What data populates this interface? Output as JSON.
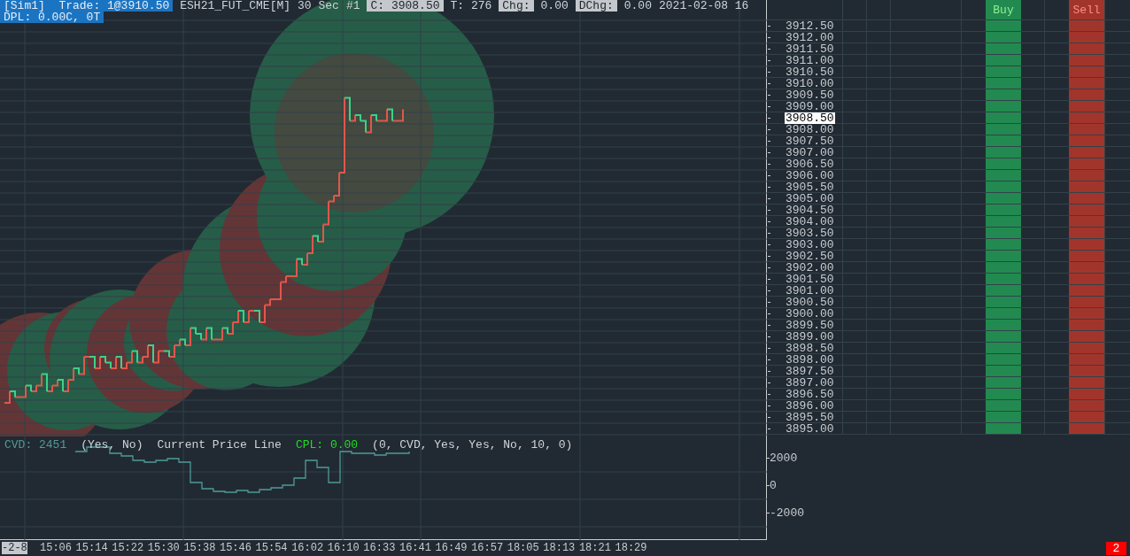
{
  "header": {
    "segments": [
      {
        "text": "[Sim1]  Trade: 1@3910.50",
        "kind": "highlight"
      },
      {
        "text": "ESH21_FUT_CME[M]",
        "kind": "plain"
      },
      {
        "text": "30 Sec",
        "kind": "plain"
      },
      {
        "text": "#1",
        "kind": "plain"
      },
      {
        "text": "C: 3908.50",
        "kind": "tag"
      },
      {
        "text": "T: 276",
        "kind": "plain"
      },
      {
        "text": "Chg:",
        "kind": "tag"
      },
      {
        "text": "0.00",
        "kind": "plain"
      },
      {
        "text": "DChg:",
        "kind": "tag"
      },
      {
        "text": "0.00",
        "kind": "plain"
      },
      {
        "text": "2021-02-08 16",
        "kind": "plain"
      }
    ],
    "dpl": "DPL: 0.00C, 0T"
  },
  "order_columns": [
    {
      "label": "Buy",
      "kind": "buy"
    },
    {
      "label": "Sell",
      "kind": "sell"
    }
  ],
  "prices": [
    {
      "text": "3912.50",
      "current": false
    },
    {
      "text": "3912.00",
      "current": false
    },
    {
      "text": "3911.50",
      "current": false
    },
    {
      "text": "3911.00",
      "current": false
    },
    {
      "text": "3910.50",
      "current": false
    },
    {
      "text": "3910.00",
      "current": false
    },
    {
      "text": "3909.50",
      "current": false
    },
    {
      "text": "3909.00",
      "current": false
    },
    {
      "text": "3908.50",
      "current": true
    },
    {
      "text": "3908.00",
      "current": false
    },
    {
      "text": "3907.50",
      "current": false
    },
    {
      "text": "3907.00",
      "current": false
    },
    {
      "text": "3906.50",
      "current": false
    },
    {
      "text": "3906.00",
      "current": false
    },
    {
      "text": "3905.50",
      "current": false
    },
    {
      "text": "3905.00",
      "current": false
    },
    {
      "text": "3904.50",
      "current": false
    },
    {
      "text": "3904.00",
      "current": false
    },
    {
      "text": "3903.50",
      "current": false
    },
    {
      "text": "3903.00",
      "current": false
    },
    {
      "text": "3902.50",
      "current": false
    },
    {
      "text": "3902.00",
      "current": false
    },
    {
      "text": "3901.50",
      "current": false
    },
    {
      "text": "3901.00",
      "current": false
    },
    {
      "text": "3900.50",
      "current": false
    },
    {
      "text": "3900.00",
      "current": false
    },
    {
      "text": "3899.50",
      "current": false
    },
    {
      "text": "3899.00",
      "current": false
    },
    {
      "text": "3898.50",
      "current": false
    },
    {
      "text": "3898.00",
      "current": false
    },
    {
      "text": "3897.50",
      "current": false
    },
    {
      "text": "3897.00",
      "current": false
    },
    {
      "text": "3896.50",
      "current": false
    },
    {
      "text": "3896.00",
      "current": false
    },
    {
      "text": "3895.50",
      "current": false
    },
    {
      "text": "3895.00",
      "current": false
    }
  ],
  "indicator": {
    "segments": [
      {
        "text": "CVD: 2451",
        "kind": "cvd"
      },
      {
        "text": "(Yes, No)",
        "kind": "plain"
      },
      {
        "text": "Current Price Line",
        "kind": "plain"
      },
      {
        "text": "CPL: 0.00",
        "kind": "cpl"
      },
      {
        "text": "(0, CVD, Yes, Yes, No, 10, 0)",
        "kind": "plain"
      }
    ],
    "axis": [
      "2000",
      "0",
      "-2000"
    ]
  },
  "time_axis": [
    {
      "text": "-2-8",
      "highlighted": true
    },
    {
      "text": "15:06",
      "highlighted": false
    },
    {
      "text": "15:14",
      "highlighted": false
    },
    {
      "text": "15:22",
      "highlighted": false
    },
    {
      "text": "15:30",
      "highlighted": false
    },
    {
      "text": "15:38",
      "highlighted": false
    },
    {
      "text": "15:46",
      "highlighted": false
    },
    {
      "text": "15:54",
      "highlighted": false
    },
    {
      "text": "16:02",
      "highlighted": false
    },
    {
      "text": "16:10",
      "highlighted": false
    },
    {
      "text": "16:33",
      "highlighted": false
    },
    {
      "text": "16:41",
      "highlighted": false
    },
    {
      "text": "16:49",
      "highlighted": false
    },
    {
      "text": "16:57",
      "highlighted": false
    },
    {
      "text": "18:05",
      "highlighted": false
    },
    {
      "text": "18:13",
      "highlighted": false
    },
    {
      "text": "18:21",
      "highlighted": false
    },
    {
      "text": "18:29",
      "highlighted": false
    }
  ],
  "alert_badge": "2"
}
